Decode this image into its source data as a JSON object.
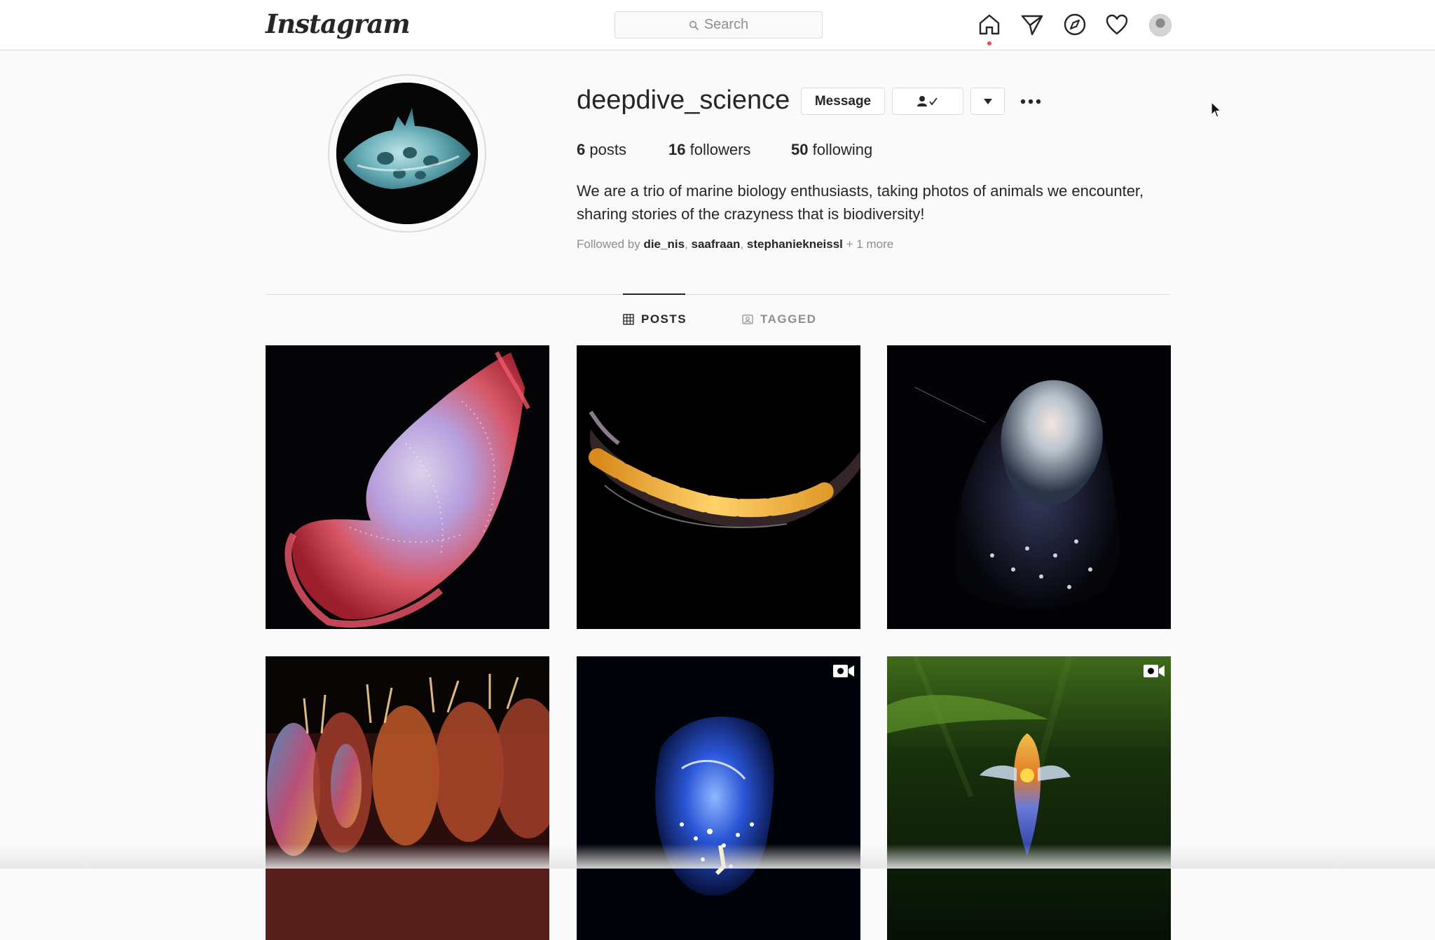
{
  "topbar": {
    "logo": "Instagram",
    "search_placeholder": "Search",
    "icons": [
      "home-icon",
      "direct-icon",
      "explore-icon",
      "activity-heart-icon",
      "profile-avatar"
    ]
  },
  "profile": {
    "username": "deepdive_science",
    "message_button": "Message",
    "stats": {
      "posts_count": "6",
      "posts_label": "posts",
      "followers_count": "16",
      "followers_label": "followers",
      "following_count": "50",
      "following_label": "following"
    },
    "bio": "We are a trio of marine biology enthusiasts, taking photos of animals we encounter, sharing stories of the crazyness that is biodiversity!",
    "followed_by": {
      "prefix": "Followed by",
      "names": [
        "die_nis",
        "saafraan",
        "stephaniekneissl"
      ],
      "separator": ", ",
      "suffix": "+ 1 more"
    }
  },
  "tabs": [
    {
      "label": "POSTS",
      "active": true
    },
    {
      "label": "TAGGED",
      "active": false
    }
  ],
  "posts": [
    {
      "subject": "red-jellyfish",
      "video": false
    },
    {
      "subject": "glowing-worm",
      "video": false
    },
    {
      "subject": "translucent-pteropod",
      "video": false
    },
    {
      "subject": "iridescent-comb-segments",
      "video": false
    },
    {
      "subject": "blue-bioluminescent-creature",
      "video": true
    },
    {
      "subject": "sea-angel-green",
      "video": true
    }
  ],
  "colors": {
    "background": "#fafafa",
    "border": "#dbdbdb",
    "text": "#262626",
    "muted": "#8e8e8e",
    "notification": "#ed4956"
  }
}
